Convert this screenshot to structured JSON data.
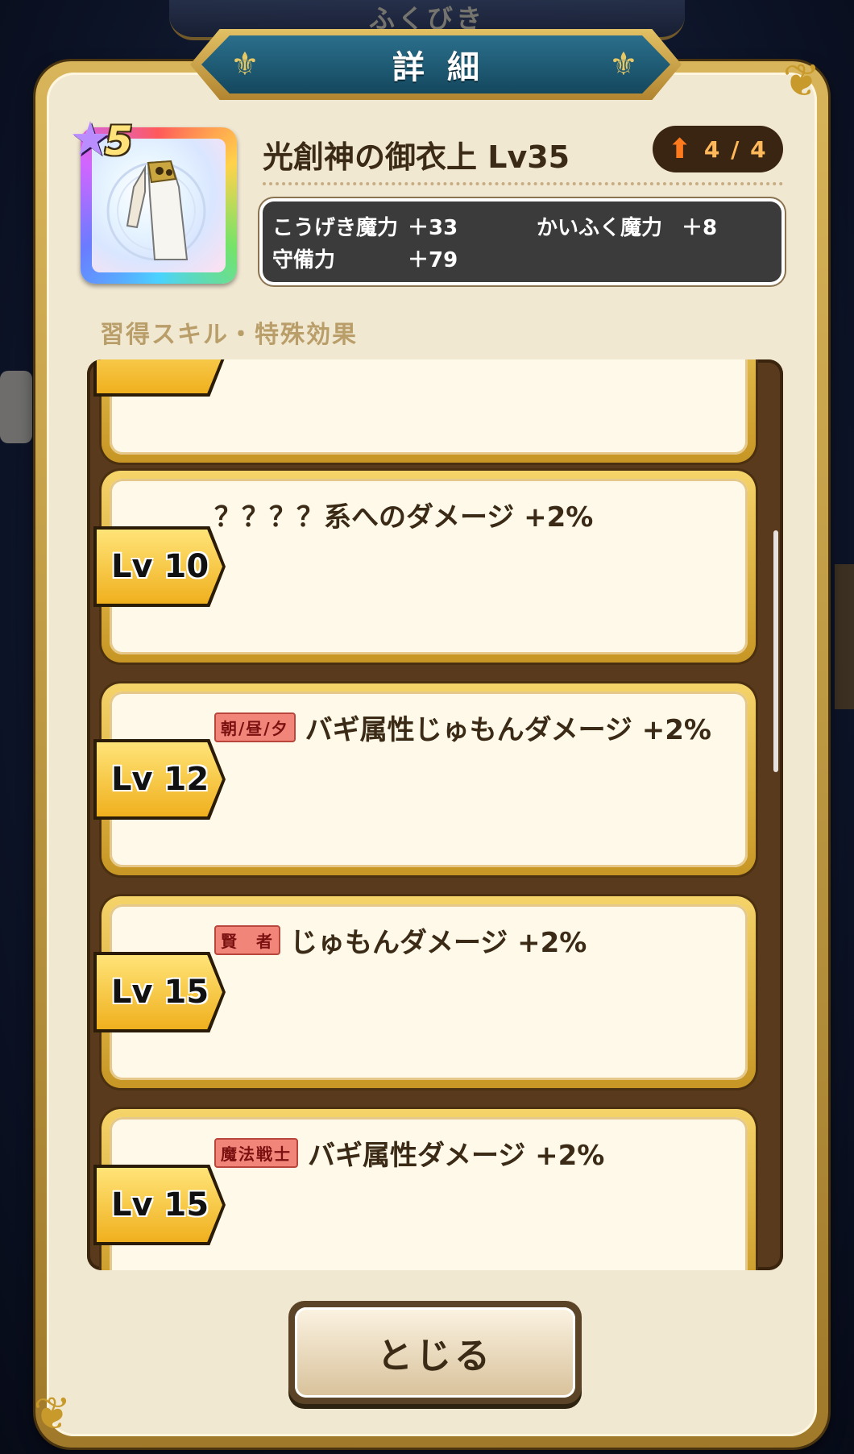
{
  "background": {
    "banner_text": "ふくびき"
  },
  "header": {
    "title": "詳細"
  },
  "item": {
    "name": "光創神の御衣上 Lv35",
    "rarity": "5",
    "rank": "4 / 4",
    "stats": [
      {
        "label": "こうげき魔力",
        "value": "＋33"
      },
      {
        "label": "かいふく魔力",
        "value": "＋8"
      },
      {
        "label": "守備力",
        "value": "＋79"
      }
    ]
  },
  "skills_section": {
    "label": "習得スキル・特殊効果",
    "skills": [
      {
        "level": "Lv 10",
        "tag": "",
        "text": "？？？？系へのダメージ +2%"
      },
      {
        "level": "Lv 12",
        "tag": "朝/昼/夕",
        "text": "バギ属性じゅもんダメージ +2%"
      },
      {
        "level": "Lv 15",
        "tag": "賢　者",
        "text": "じゅもんダメージ +2%"
      },
      {
        "level": "Lv 15",
        "tag": "魔法戦士",
        "text": "バギ属性ダメージ +2%"
      }
    ]
  },
  "close_button": {
    "label": "とじる"
  },
  "colors": {
    "accent_gold": "#d8b45a",
    "header_blue": "#1c5a74",
    "card_bg": "#fff9e9"
  }
}
